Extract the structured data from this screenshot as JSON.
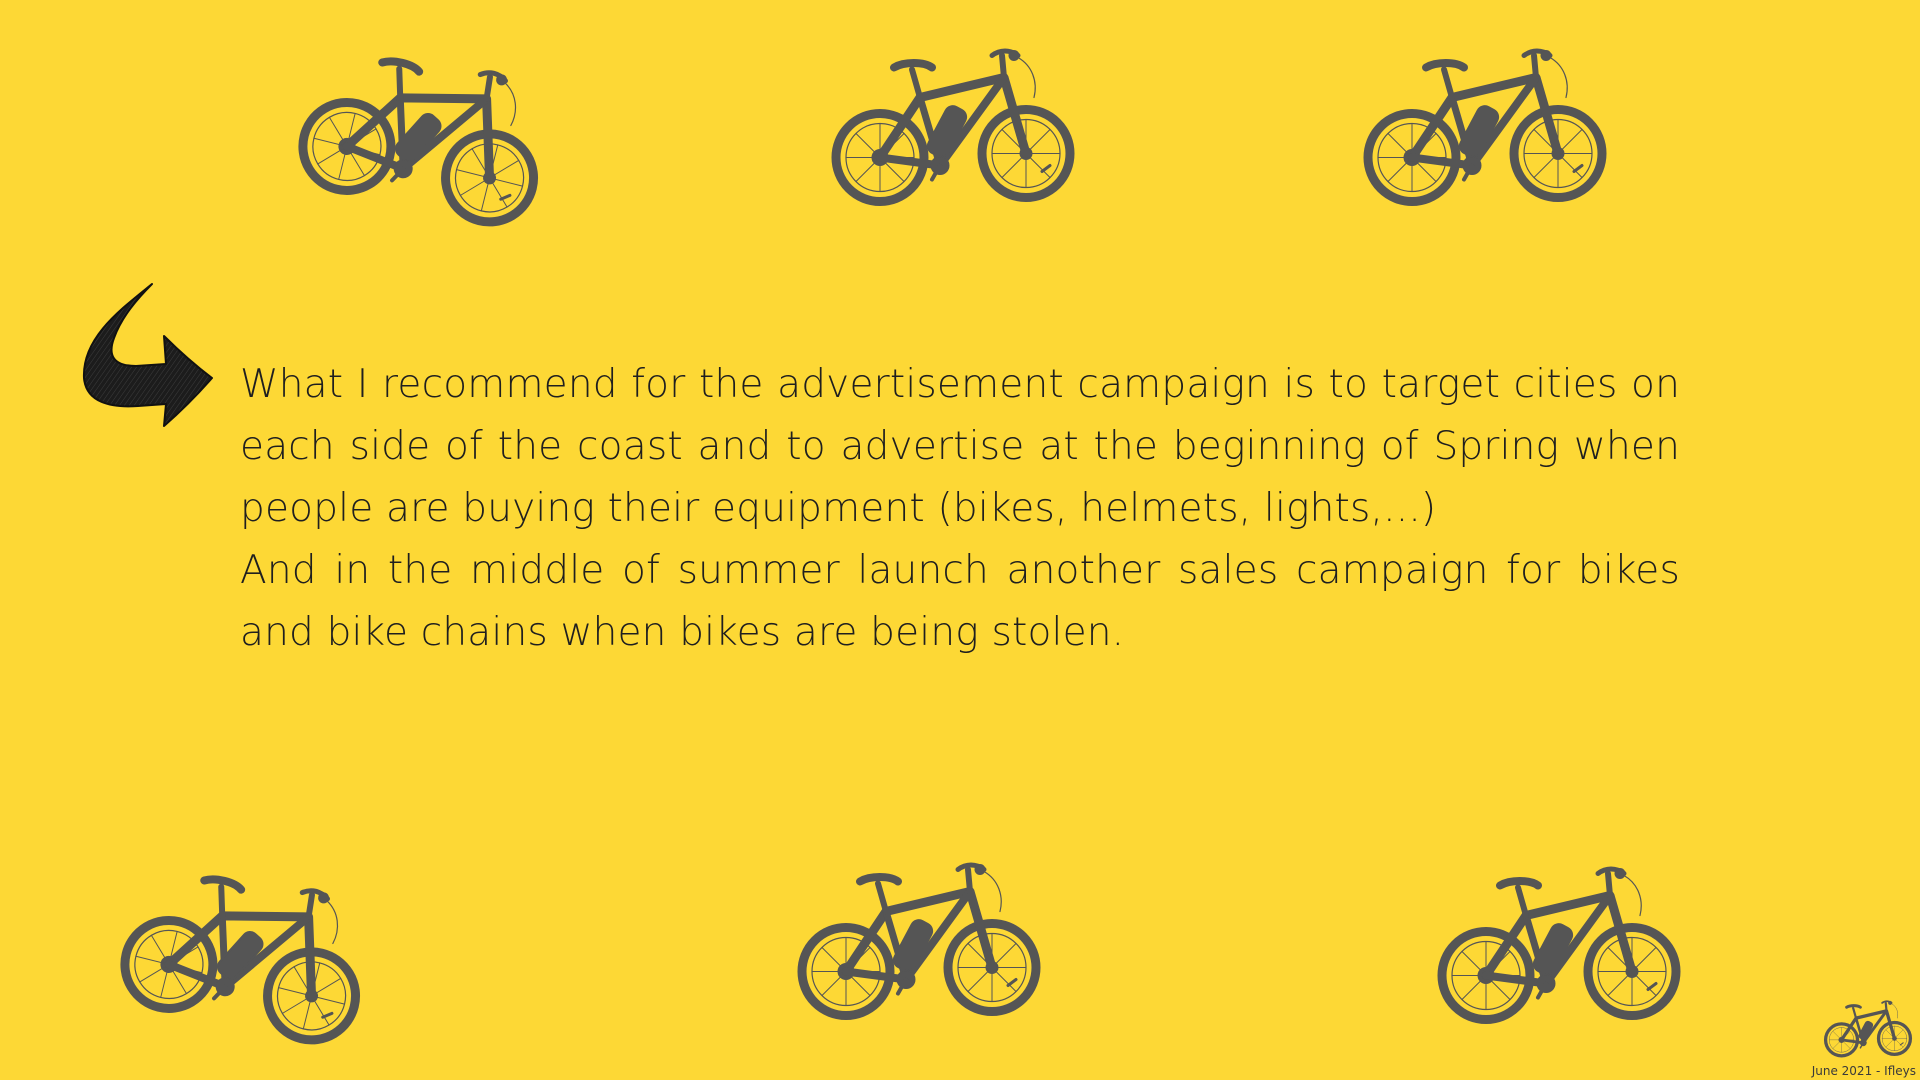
{
  "slide": {
    "background_color": "#fdd835",
    "text_color": "#1f1f1f",
    "bike_color": "#555555",
    "recommendation": {
      "paragraph_1": "What I recommend for the advertisement campaign is to target cities on each side of the coast and to advertise at the beginning of Spring when people are buying their equipment (bikes, helmets, lights,...)",
      "paragraph_2": "And in the middle of summer launch another sales campaign for bikes and bike chains when bikes are being stolen."
    },
    "footer": {
      "text": "June 2021 - Ifleys"
    },
    "icons": {
      "arrow": "curved-arrow-right-icon",
      "bike": "e-bike-icon"
    }
  }
}
